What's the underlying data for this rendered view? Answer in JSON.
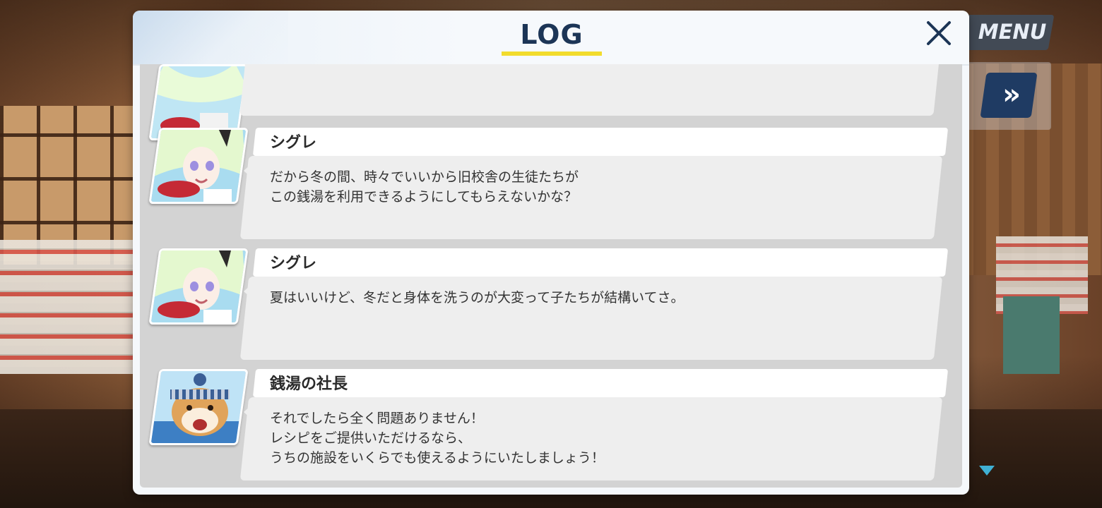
{
  "header": {
    "title": "LOG",
    "accent_color": "#f2dc2c",
    "close_icon": "close-icon"
  },
  "hud": {
    "menu_label": "MENU",
    "skip_icon": "fast-forward-icon",
    "scroll_icon": "scroll-down-icon"
  },
  "log": {
    "entries": [
      {
        "speaker": "",
        "text": "",
        "avatar": "shigure-portrait"
      },
      {
        "speaker": "シグレ",
        "text": "だから冬の間、時々でいいから旧校舎の生徒たちが\nこの銭湯を利用できるようにしてもらえないかな？",
        "avatar": "shigure-portrait"
      },
      {
        "speaker": "シグレ",
        "text": "夏はいいけど、冬だと身体を洗うのが大変って子たちが結構いてさ。",
        "avatar": "shigure-portrait"
      },
      {
        "speaker": "銭湯の社長",
        "text": "それでしたら全く問題ありません！\nレシピをご提供いただけるなら、\nうちの施設をいくらでも使えるようにいたしましょう！",
        "avatar": "shiba-dog-portrait"
      }
    ]
  }
}
